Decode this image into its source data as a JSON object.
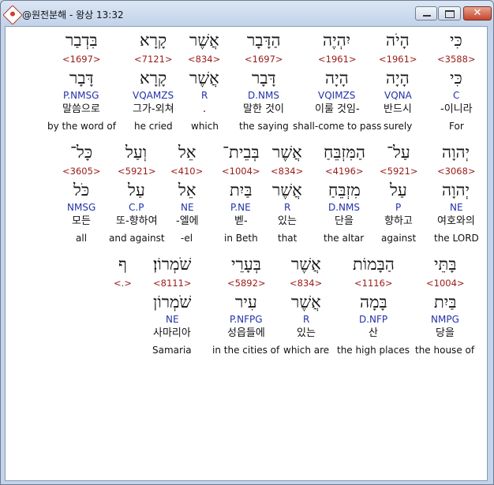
{
  "window": {
    "title": "@원전분해 - 왕상 13:32",
    "close_glyph": "✕"
  },
  "rows": [
    {
      "words": [
        {
          "heb": "כִּי",
          "strong": "<3588>",
          "lemma": "כִּי",
          "parse": "C",
          "kor": "-이니라",
          "eng": "For"
        },
        {
          "heb": "הָיֹה",
          "strong": "<1961>",
          "lemma": "הָיָה",
          "parse": "VQNA",
          "kor": "반드시",
          "eng": "surely"
        },
        {
          "heb": "יִהְיֶה",
          "strong": "<1961>",
          "lemma": "הָיָה",
          "parse": "VQIMZS",
          "kor": "이룰 것임-",
          "eng": "shall-come to pass"
        },
        {
          "heb": "הַדָּבָר",
          "strong": "<1697>",
          "lemma": "דָּבָר",
          "parse": "D.NMS",
          "kor": "말한 것이",
          "eng": "the saying"
        },
        {
          "heb": "אֲשֶׁר",
          "strong": "<834>",
          "lemma": "אֲשֶׁר",
          "parse": "R",
          "kor": ".",
          "eng": "which"
        },
        {
          "heb": "קָרָא",
          "strong": "<7121>",
          "lemma": "קָרָא",
          "parse": "VQAMZS",
          "kor": "그가-외쳐",
          "eng": "he cried"
        },
        {
          "heb": "בִּדְבַר",
          "strong": "<1697>",
          "lemma": "דָּבָר",
          "parse": "P.NMSG",
          "kor": "말씀으로",
          "eng": "by the word of"
        }
      ]
    },
    {
      "words": [
        {
          "heb": "יְהוָה",
          "strong": "<3068>",
          "lemma": "יְהוָה",
          "parse": "NE",
          "kor": "여호와의",
          "eng": "the LORD"
        },
        {
          "heb": "עַל־",
          "strong": "<5921>",
          "lemma": "עַל",
          "parse": "P",
          "kor": "향하고",
          "eng": "against"
        },
        {
          "heb": "הַמִּזְבֵּחַ",
          "strong": "<4196>",
          "lemma": "מִזְבֵּחַ",
          "parse": "D.NMS",
          "kor": "단을",
          "eng": "the altar"
        },
        {
          "heb": "אֲשֶׁר",
          "strong": "<834>",
          "lemma": "אֲשֶׁר",
          "parse": "R",
          "kor": "있는",
          "eng": "that"
        },
        {
          "heb": "בְּבֵית־",
          "strong": "<1004>",
          "lemma": "בַּיִת",
          "parse": "P.NE",
          "kor": "벧-",
          "eng": "in Beth"
        },
        {
          "heb": "אֵל",
          "strong": "<410>",
          "lemma": "אֵל",
          "parse": "NE",
          "kor": "-엘에",
          "eng": "-el"
        },
        {
          "heb": "וְעַל",
          "strong": "<5921>",
          "lemma": "עַל",
          "parse": "C.P",
          "kor": "또-향하여",
          "eng": "and against"
        },
        {
          "heb": "כָּל־",
          "strong": "<3605>",
          "lemma": "כֹּל",
          "parse": "NMSG",
          "kor": "모든",
          "eng": "all"
        }
      ]
    },
    {
      "words": [
        {
          "heb": "בָּתֵּי",
          "strong": "<1004>",
          "lemma": "בַּיִת",
          "parse": "NMPG",
          "kor": "당을",
          "eng": "the house of"
        },
        {
          "heb": "הַבָּמוֹת",
          "strong": "<1116>",
          "lemma": "בָּמָה",
          "parse": "D.NFP",
          "kor": "산",
          "eng": "the high places"
        },
        {
          "heb": "אֲשֶׁר",
          "strong": "<834>",
          "lemma": "אֲשֶׁר",
          "parse": "R",
          "kor": "있는",
          "eng": "which are"
        },
        {
          "heb": "בְּעָרֵי",
          "strong": "<5892>",
          "lemma": "עִיר",
          "parse": "P.NFPG",
          "kor": "성읍들에",
          "eng": "in the cities of"
        },
        {
          "heb": "שֹׁמְרוֹן׃",
          "strong": "<8111>",
          "lemma": "שֹׁמְרוֹן",
          "parse": "NE",
          "kor": "사마리아",
          "eng": "Samaria"
        },
        {
          "heb": "ף",
          "strong": "<.>",
          "lemma": "",
          "parse": "",
          "kor": "",
          "eng": ""
        }
      ]
    }
  ]
}
